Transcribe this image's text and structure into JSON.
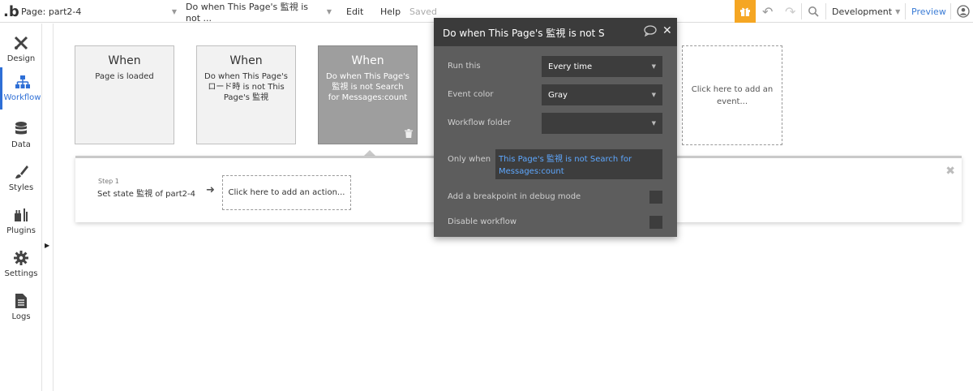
{
  "topbar": {
    "logo": ".b",
    "page_label": "Page: part2-4",
    "workflow_label": "Do when This Page's 監視 is not ...",
    "edit": "Edit",
    "help": "Help",
    "saved": "Saved",
    "environment": "Development",
    "preview": "Preview"
  },
  "sidebar": {
    "items": [
      {
        "label": "Design",
        "icon": "design-icon"
      },
      {
        "label": "Workflow",
        "icon": "workflow-icon"
      },
      {
        "label": "Data",
        "icon": "database-icon"
      },
      {
        "label": "Styles",
        "icon": "brush-icon"
      },
      {
        "label": "Plugins",
        "icon": "plugin-icon"
      },
      {
        "label": "Settings",
        "icon": "gear-icon"
      },
      {
        "label": "Logs",
        "icon": "document-icon"
      }
    ]
  },
  "events": [
    {
      "when": "When",
      "desc": "Page is loaded"
    },
    {
      "when": "When",
      "desc": "Do when This Page's ロード時 is not This Page's 監視"
    },
    {
      "when": "When",
      "desc": "Do when This Page's 監視 is not Search for Messages:count"
    }
  ],
  "add_event": "Click here to add an event...",
  "step": {
    "number": "Step 1",
    "title": "Set state 監視 of part2-4",
    "add_action": "Click here to add an action..."
  },
  "property_editor": {
    "title": "Do when This Page's 監視 is not Search for Messages:count",
    "run_this_label": "Run this",
    "run_this_value": "Every time",
    "event_color_label": "Event color",
    "event_color_value": "Gray",
    "workflow_folder_label": "Workflow folder",
    "workflow_folder_value": "",
    "only_when_label": "Only when",
    "only_when_value": "This Page's 監視 is not Search for Messages:count",
    "breakpoint_label": "Add a breakpoint in debug mode",
    "disable_label": "Disable workflow"
  },
  "colors": {
    "accent": "#2e6fd6",
    "gift": "#f5a623",
    "expression": "#5ea8ff"
  }
}
